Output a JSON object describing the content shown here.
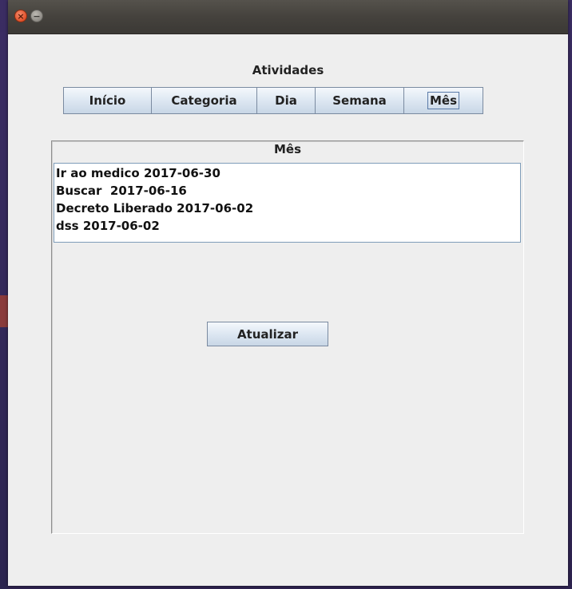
{
  "app": {
    "title": "Atividades"
  },
  "tabs": [
    {
      "label": "Início"
    },
    {
      "label": "Categoria"
    },
    {
      "label": "Dia"
    },
    {
      "label": "Semana"
    },
    {
      "label": "Mês",
      "selected": true
    }
  ],
  "panel": {
    "title": "Mês",
    "items": [
      {
        "text": "Ir ao medico 2017-06-30"
      },
      {
        "text": "Buscar  2017-06-16"
      },
      {
        "text": "Decreto Liberado 2017-06-02"
      },
      {
        "text": "dss 2017-06-02"
      }
    ],
    "refresh_label": "Atualizar"
  },
  "icons": {
    "close": "close-icon",
    "minimize": "minimize-icon"
  },
  "colors": {
    "desktop": "#3b2d63",
    "titlebar": "#45423d",
    "window_bg": "#eeeeee",
    "close_button": "#e0512a",
    "list_border": "#7f9db9"
  }
}
